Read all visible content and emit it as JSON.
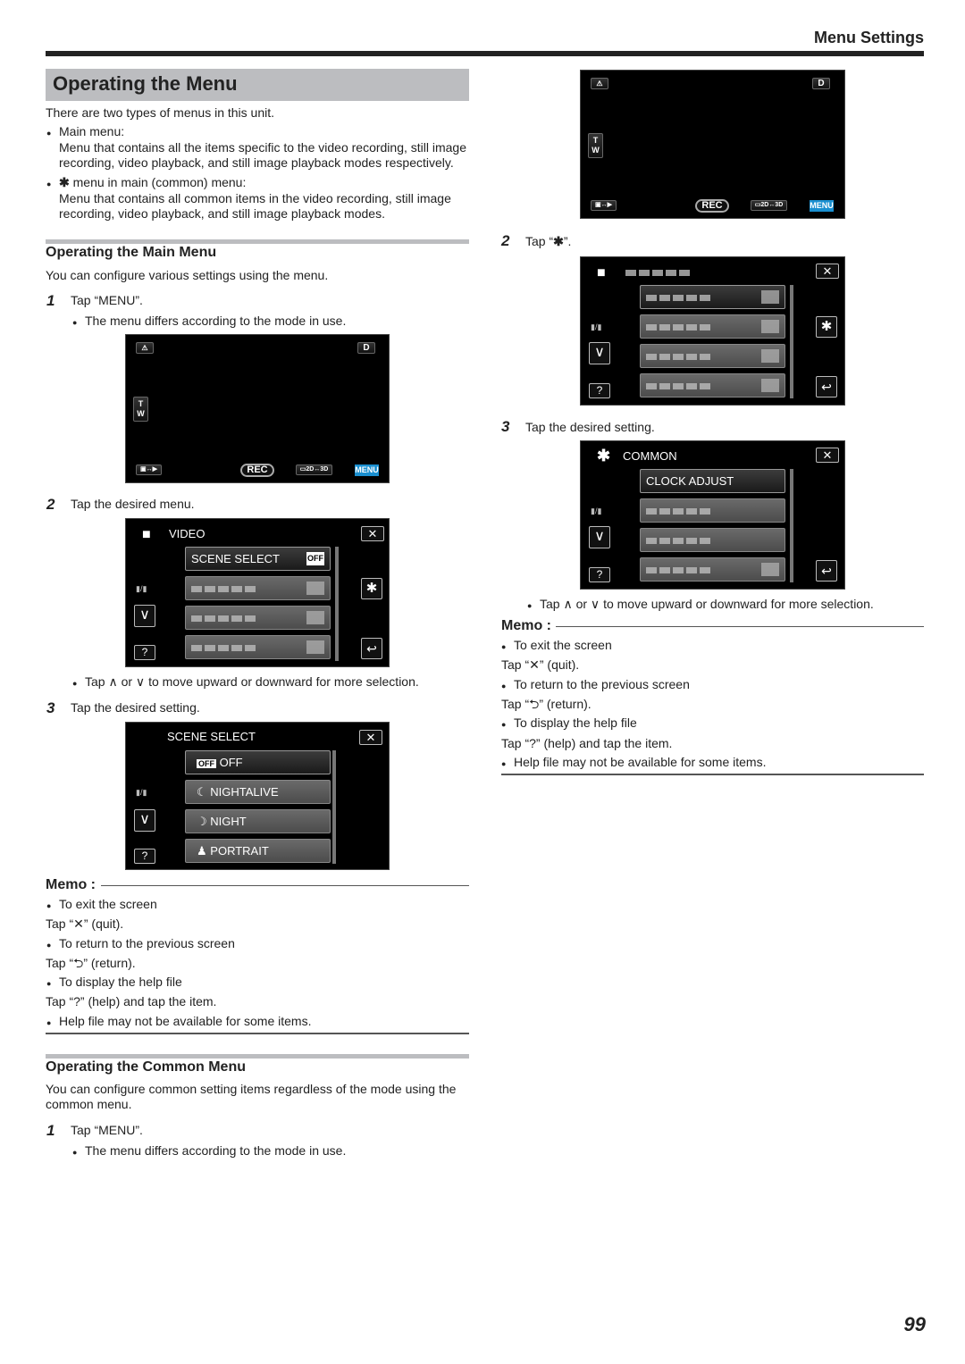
{
  "header": {
    "title": "Menu Settings"
  },
  "section": {
    "title": "Operating the Menu",
    "intro": "There are two types of menus in this unit.",
    "types": [
      {
        "label": "Main menu:",
        "desc1": "Menu that contains all the items specific to the video recording, still image",
        "desc2": "recording, video playback, and still image playback modes respectively."
      },
      {
        "label": "menu in main (common) menu:",
        "desc1": "Menu that contains all common items in the video recording, still image",
        "desc2": "recording, video playback, and still image playback modes."
      }
    ]
  },
  "main_menu": {
    "heading": "Operating the Main Menu",
    "intro": "You can configure various settings using the menu.",
    "steps": [
      {
        "num": "1",
        "text": "Tap “MENU”.",
        "note": "The menu differs according to the mode in use."
      },
      {
        "num": "2",
        "text": "Tap the desired menu.",
        "note": "Tap ∧ or ∨ to move upward or downward for more selection."
      },
      {
        "num": "3",
        "text": "Tap the desired setting."
      }
    ]
  },
  "common_menu": {
    "heading": "Operating the Common Menu",
    "intro1": "You can configure common setting items regardless of the mode using the",
    "intro2": "common menu.",
    "steps": [
      {
        "num": "1",
        "text": "Tap “MENU”.",
        "note": "The menu differs according to the mode in use."
      },
      {
        "num": "2",
        "text_pre": "Tap “",
        "text_post": "”."
      },
      {
        "num": "3",
        "text": "Tap the desired setting.",
        "note": "Tap ∧ or ∨ to move upward or downward for more selection."
      }
    ]
  },
  "memo": {
    "title": "Memo :",
    "lines": [
      {
        "bullet": true,
        "text": "To exit the screen"
      },
      {
        "bullet": false,
        "text": "Tap “✕” (quit)."
      },
      {
        "bullet": true,
        "text": "To return to the previous screen"
      },
      {
        "bullet": false,
        "text": "Tap “⮌” (return)."
      },
      {
        "bullet": true,
        "text": "To display the help file"
      },
      {
        "bullet": false,
        "text": "Tap “?” (help) and tap the item."
      },
      {
        "bullet": true,
        "text": "Help file may not be available for some items."
      }
    ]
  },
  "camera_screen": {
    "top_left": "⚠",
    "top_right": "D",
    "zoom_t": "T",
    "zoom_w": "W",
    "mode_switch": "▣↔▶",
    "rec": "REC",
    "dim_switch": "▭2D↔3D",
    "menu": "MENU"
  },
  "video_menu_screen": {
    "title": "VIDEO",
    "page": "▮/▮",
    "items": [
      {
        "label": "SCENE SELECT",
        "value": "OFF"
      }
    ]
  },
  "scene_select_screen": {
    "title": "SCENE SELECT",
    "page": "▮/▮",
    "items": [
      {
        "icon": "OFF",
        "label": "OFF"
      },
      {
        "icon": "☾",
        "label": "NIGHTALIVE"
      },
      {
        "icon": "☽",
        "label": "NIGHT"
      },
      {
        "icon": "♟",
        "label": "PORTRAIT"
      }
    ]
  },
  "common_screen": {
    "title": "COMMON",
    "page": "▮/▮",
    "items": [
      {
        "label": "CLOCK ADJUST"
      }
    ]
  },
  "page_number": "99",
  "colors": {
    "section_bar": "#bcbdc0",
    "menu_button": "#1a8fd0"
  }
}
